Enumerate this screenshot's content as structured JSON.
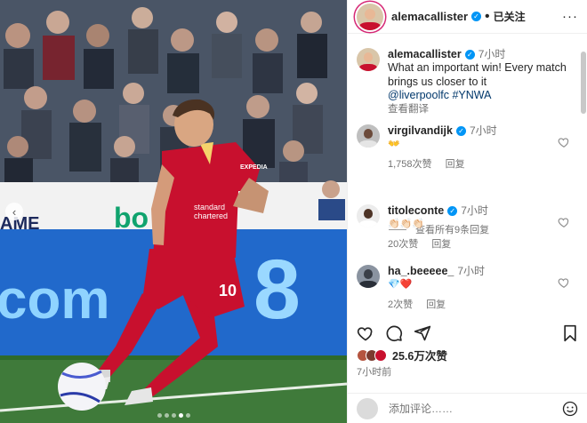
{
  "post": {
    "author": "alemacallister",
    "follow_status": "已关注",
    "caption_time": "7小时",
    "caption_line1": "What an important win! Every match",
    "caption_line2": "brings us closer to it",
    "caption_link1": "@liverpoolfc",
    "caption_link2": "#YNWA",
    "translate_label": "查看翻译",
    "likes": "25.6万次赞",
    "posted_ago": "7小时前"
  },
  "photo": {
    "carousel_count": 5,
    "active_index": 3,
    "shirt_text1": "standard",
    "shirt_text2": "chartered",
    "shirt_number": "10",
    "sleeve": "EXPEDIA",
    "board_text1": "com",
    "board_text2": "8",
    "board_text3": "AME",
    "board_text4": "bo"
  },
  "comments": [
    {
      "user": "virgilvandijk",
      "verified": true,
      "time": "7小时",
      "text": "👐",
      "likes": "1,758次赞",
      "reply": "回复"
    },
    {
      "user": "titoleconte",
      "verified": true,
      "time": "7小时",
      "text": "👏🏻👏🏻👏🏻",
      "likes": "20次赞",
      "reply": "回复"
    },
    {
      "user": "ha_.beeeee_",
      "verified": false,
      "time": "7小时",
      "text": "💎❤️",
      "likes": "2次赞",
      "reply": "回复"
    }
  ],
  "view_replies": "查看所有9条回复",
  "add_comment": {
    "placeholder": "添加评论……"
  },
  "colors": {
    "accent": "#0095f6",
    "link": "#00376b",
    "liverpool_red": "#c8102e",
    "heart_red": "#ed4956"
  },
  "icons": [
    "more-icon",
    "verified-icon",
    "heart-icon",
    "comment-icon",
    "share-icon",
    "bookmark-icon",
    "emoji-icon",
    "chevron-left-icon"
  ]
}
